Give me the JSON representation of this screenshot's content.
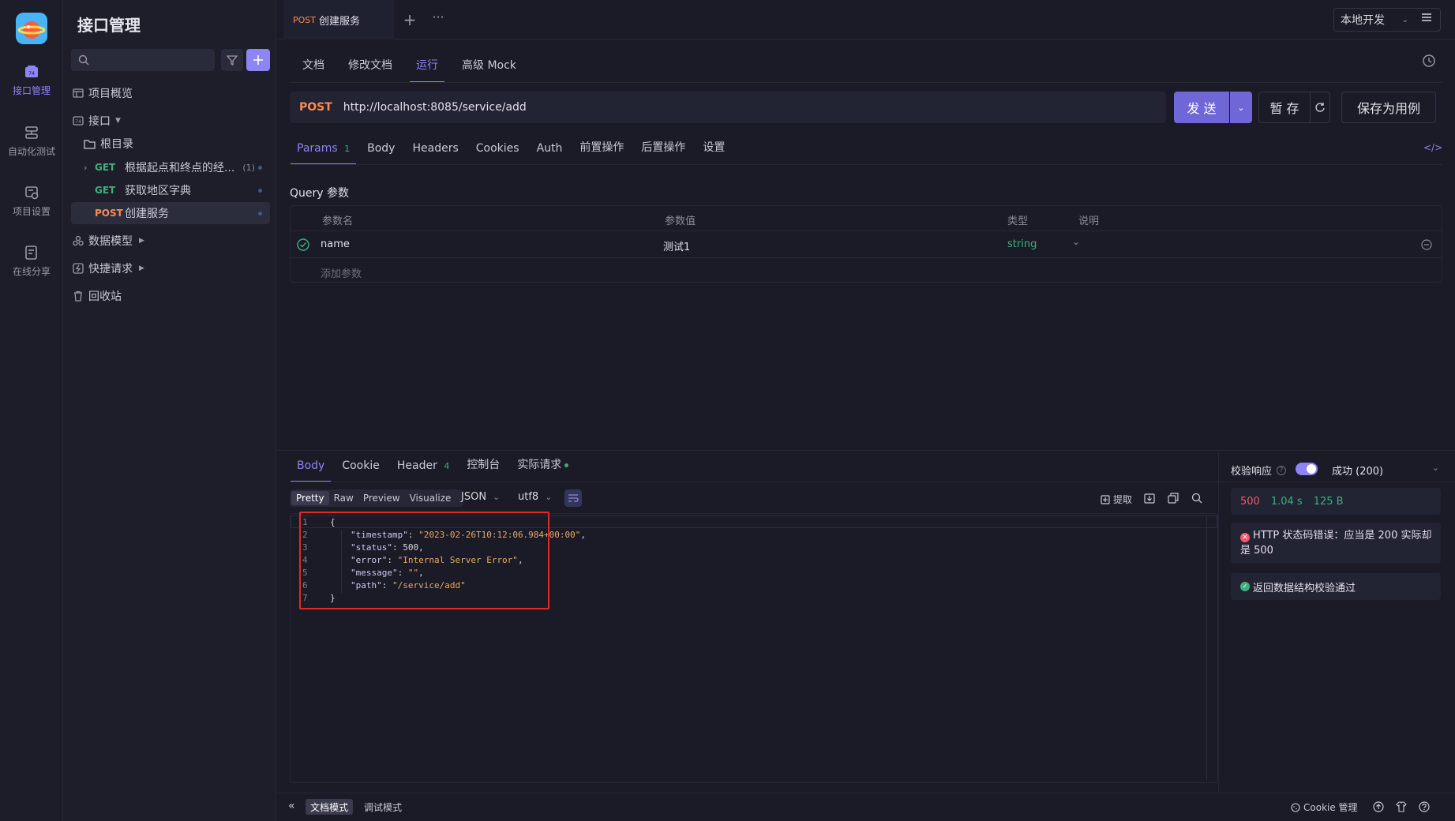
{
  "rail": {
    "items": [
      {
        "label": "接口管理",
        "icon": "api-icon"
      },
      {
        "label": "自动化测试",
        "icon": "automation-icon"
      },
      {
        "label": "项目设置",
        "icon": "settings-icon"
      },
      {
        "label": "在线分享",
        "icon": "share-icon"
      }
    ]
  },
  "sidebar": {
    "title": "接口管理",
    "search_placeholder": "",
    "overview": "项目概览",
    "interfaces": "接口",
    "root": "根目录",
    "apis": [
      {
        "method": "GET",
        "name": "根据起点和终点的经...",
        "count": "(1)"
      },
      {
        "method": "GET",
        "name": "获取地区字典",
        "count": ""
      },
      {
        "method": "POST",
        "name": "创建服务",
        "count": ""
      }
    ],
    "data_model": "数据模型",
    "quick_request": "快捷请求",
    "recycle": "回收站"
  },
  "topbar": {
    "tab_method": "POST",
    "tab_name": "创建服务",
    "env": "本地开发"
  },
  "doc_tabs": [
    "文档",
    "修改文档",
    "运行",
    "高级 Mock"
  ],
  "request": {
    "method": "POST",
    "url": "http://localhost:8085/service/add",
    "send": "发 送",
    "save_temp": "暂 存",
    "save_case": "保存为用例"
  },
  "param_tabs": [
    {
      "label": "Params",
      "badge": "1"
    },
    {
      "label": "Body",
      "badge": ""
    },
    {
      "label": "Headers",
      "badge": ""
    },
    {
      "label": "Cookies",
      "badge": ""
    },
    {
      "label": "Auth",
      "badge": ""
    },
    {
      "label": "前置操作",
      "badge": ""
    },
    {
      "label": "后置操作",
      "badge": ""
    },
    {
      "label": "设置",
      "badge": ""
    }
  ],
  "query": {
    "title": "Query 参数",
    "headers": [
      "参数名",
      "参数值",
      "类型",
      "说明"
    ],
    "rows": [
      {
        "name": "name",
        "value": "测试1",
        "type": "string",
        "desc": ""
      }
    ],
    "add": "添加参数"
  },
  "response": {
    "tabs": [
      {
        "label": "Body",
        "badge": ""
      },
      {
        "label": "Cookie",
        "badge": ""
      },
      {
        "label": "Header",
        "badge": "4"
      },
      {
        "label": "控制台",
        "badge": ""
      },
      {
        "label": "实际请求",
        "badge": ""
      }
    ],
    "view_modes": [
      "Pretty",
      "Raw",
      "Preview",
      "Visualize"
    ],
    "format": "JSON",
    "encoding": "utf8",
    "extract": "提取",
    "lines": [
      {
        "n": "1",
        "text": "{"
      },
      {
        "n": "2",
        "key": "\"timestamp\"",
        "val": "\"2023-02-26T10:12:06.984+00:00\"",
        "tail": ","
      },
      {
        "n": "3",
        "key": "\"status\"",
        "val": "500",
        "tail": ","
      },
      {
        "n": "4",
        "key": "\"error\"",
        "val": "\"Internal Server Error\"",
        "tail": ","
      },
      {
        "n": "5",
        "key": "\"message\"",
        "val": "\"\"",
        "tail": ","
      },
      {
        "n": "6",
        "key": "\"path\"",
        "val": "\"/service/add\"",
        "tail": ""
      },
      {
        "n": "7",
        "text": "}"
      }
    ]
  },
  "validation": {
    "label": "校验响应",
    "result": "成功 (200)",
    "status_code": "500",
    "time": "1.04 s",
    "size": "125 B",
    "error": "HTTP 状态码错误：应当是 200 实际却是 500",
    "pass": "返回数据结构校验通过"
  },
  "footer": {
    "doc_mode": "文档模式",
    "debug_mode": "调试模式",
    "cookie": "Cookie 管理"
  },
  "colors": {
    "accent": "#8d84f5",
    "post": "#ff8a4c",
    "get": "#3fb07d",
    "error": "#ef5b6b",
    "success": "#3fb07d",
    "highlight": "#e02a2a"
  }
}
